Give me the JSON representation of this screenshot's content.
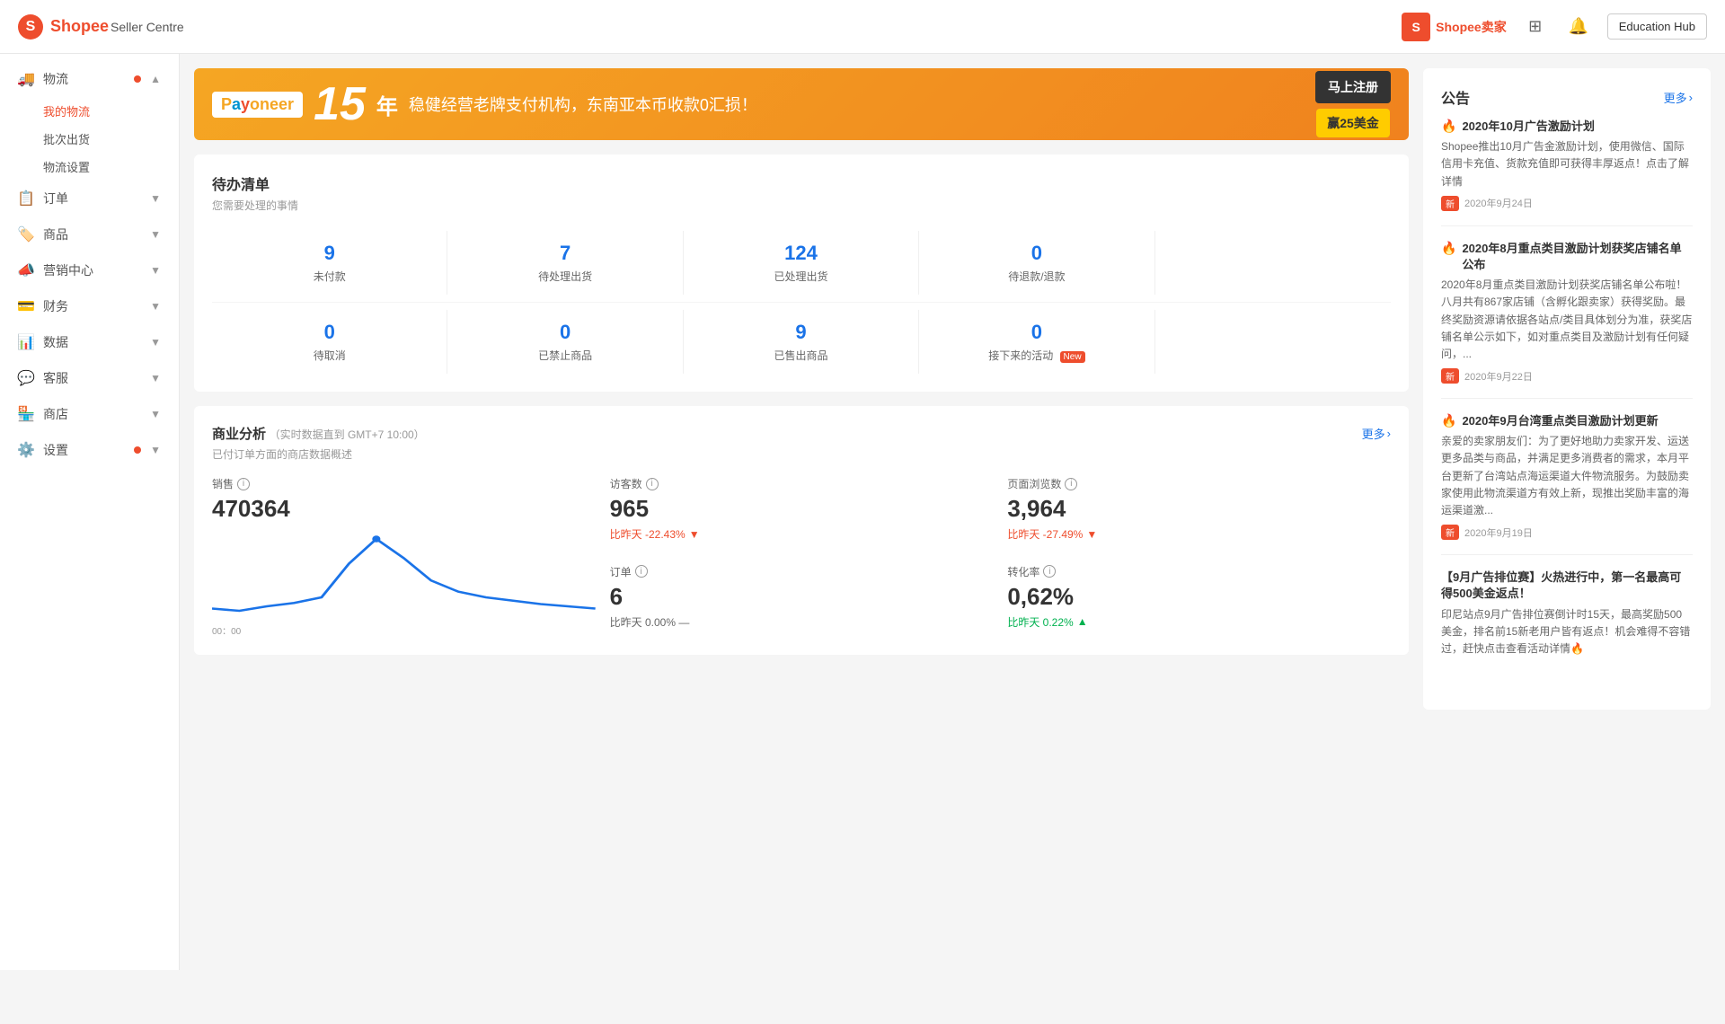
{
  "header": {
    "logo_icon": "S",
    "logo_shopee": "Shopee",
    "logo_sub": "Seller Centre",
    "shopee_buy_text": "Shopee卖家",
    "education_hub_label": "Education Hub"
  },
  "sidebar": {
    "items": [
      {
        "id": "logistics",
        "label": "物流",
        "icon": "🚚",
        "has_dot": true,
        "expanded": true
      },
      {
        "id": "my-logistics",
        "label": "我的物流",
        "type": "sub",
        "active": true
      },
      {
        "id": "batch-ship",
        "label": "批次出货",
        "type": "sub"
      },
      {
        "id": "logistics-settings",
        "label": "物流设置",
        "type": "sub"
      },
      {
        "id": "orders",
        "label": "订单",
        "icon": "📋",
        "has_dot": false
      },
      {
        "id": "products",
        "label": "商品",
        "icon": "🏷️",
        "has_dot": false
      },
      {
        "id": "marketing",
        "label": "营销中心",
        "icon": "📣",
        "has_dot": false
      },
      {
        "id": "finance",
        "label": "财务",
        "icon": "💳",
        "has_dot": false
      },
      {
        "id": "data",
        "label": "数据",
        "icon": "📊",
        "has_dot": false
      },
      {
        "id": "customer-service",
        "label": "客服",
        "icon": "💬",
        "has_dot": false
      },
      {
        "id": "shop",
        "label": "商店",
        "icon": "🏪",
        "has_dot": false
      },
      {
        "id": "settings",
        "label": "设置",
        "icon": "⚙️",
        "has_dot": true
      }
    ]
  },
  "banner": {
    "payoneer": "Payoneer",
    "years": "15",
    "nian": "年",
    "text": "稳健经营老牌支付机构，东南亚本币收款0汇损！",
    "btn_top": "马上注册",
    "btn_bottom": "赢25美金"
  },
  "todo": {
    "title": "待办清单",
    "subtitle": "您需要处理的事情",
    "items": [
      {
        "num": "9",
        "label": "未付款",
        "color": "blue"
      },
      {
        "num": "7",
        "label": "待处理出货",
        "color": "blue"
      },
      {
        "num": "124",
        "label": "已处理出货",
        "color": "blue"
      },
      {
        "num": "0",
        "label": "待退款/退款",
        "color": "blue"
      }
    ],
    "items2": [
      {
        "num": "0",
        "label": "待取消",
        "color": "blue"
      },
      {
        "num": "0",
        "label": "已禁止商品",
        "color": "blue"
      },
      {
        "num": "9",
        "label": "已售出商品",
        "color": "blue"
      },
      {
        "num": "0",
        "label": "接下来的活动",
        "color": "blue",
        "has_new": true
      }
    ]
  },
  "analytics": {
    "title": "商业分析",
    "realtime_info": "（实时数据直到 GMT+7 10:00）",
    "subtitle": "已付订单方面的商店数据概述",
    "more_label": "更多",
    "sales_label": "销售",
    "sales_value": "470364",
    "visitors_label": "访客数",
    "visitors_value": "965",
    "visitors_change": "比昨天 -22.43%",
    "visitors_change_dir": "down",
    "pageviews_label": "页面浏览数",
    "pageviews_value": "3,964",
    "pageviews_change": "比昨天 -27.49%",
    "pageviews_change_dir": "down",
    "orders_label": "订单",
    "orders_value": "6",
    "orders_change": "比昨天 0.00% —",
    "orders_change_dir": "neutral",
    "conversion_label": "转化率",
    "conversion_value": "0,62%",
    "conversion_change": "比昨天 0.22%",
    "conversion_change_dir": "up",
    "chart_time": "00：00",
    "chart_points": [
      10,
      8,
      12,
      15,
      45,
      90,
      60,
      40,
      20,
      15,
      12,
      10,
      8,
      6,
      5
    ]
  },
  "announcements": {
    "title": "公告",
    "more_label": "更多",
    "items": [
      {
        "title": "2020年10月广告激励计划",
        "content": "Shopee推出10月广告金激励计划，使用微信、国际信用卡充值、货款充值即可获得丰厚返点！点击了解详情",
        "date": "2020年9月24日",
        "is_new": true,
        "has_fire": true
      },
      {
        "title": "2020年8月重点类目激励计划获奖店铺名单公布",
        "content": "2020年8月重点类目激励计划获奖店铺名单公布啦！八月共有867家店铺（含孵化跟卖家）获得奖励。最终奖励资源请依据各站点/类目具体划分为准，获奖店铺名单公示如下，如对重点类目及激励计划有任何疑问，...",
        "date": "2020年9月22日",
        "is_new": true,
        "has_fire": true
      },
      {
        "title": "2020年9月台湾重点类目激励计划更新",
        "content": "亲爱的卖家朋友们：为了更好地助力卖家开发、运送更多品类与商品，并满足更多消费者的需求，本月平台更新了台湾站点海运渠道大件物流服务。为鼓励卖家使用此物流渠道方有效上新，现推出奖励丰富的海运渠道激...",
        "date": "2020年9月19日",
        "is_new": true,
        "has_fire": true
      },
      {
        "title": "【9月广告排位赛】火热进行中，第一名最高可得500美金返点！",
        "content": "印尼站点9月广告排位赛倒计时15天，最高奖励500美金，排名前15新老用户皆有返点！机会难得不容错过，赶快点击查看活动详情🔥",
        "date": "",
        "is_new": false,
        "has_fire": false
      }
    ]
  }
}
